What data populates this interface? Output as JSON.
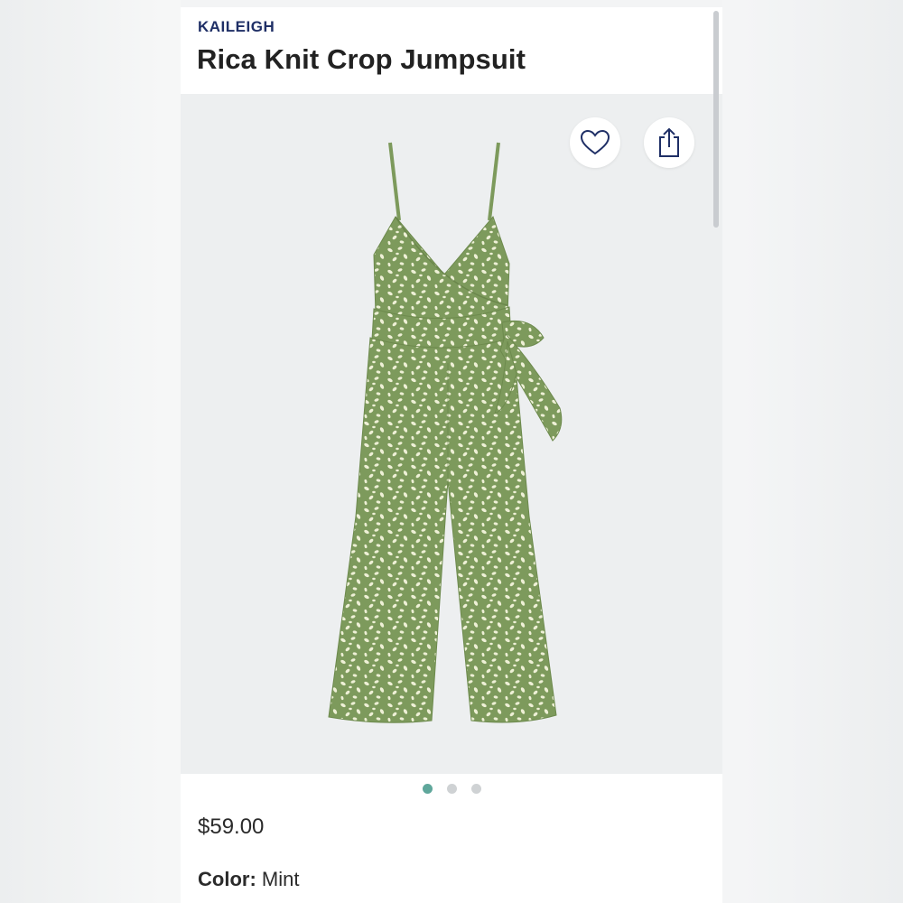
{
  "product": {
    "brand": "KAILEIGH",
    "title": "Rica Knit Crop Jumpsuit",
    "price": "$59.00",
    "color_label": "Color:",
    "color_value": "Mint"
  },
  "gallery": {
    "image_count": 3,
    "active_index": 0,
    "garment_color": "#7d9a5c",
    "print_color": "#eef0d6"
  },
  "icons": {
    "favorite": "heart-outline-icon",
    "share": "share-upload-icon"
  },
  "colors": {
    "brand_text": "#1f2f66",
    "active_dot": "#5fa79b",
    "inactive_dot": "#cfd2d4"
  }
}
